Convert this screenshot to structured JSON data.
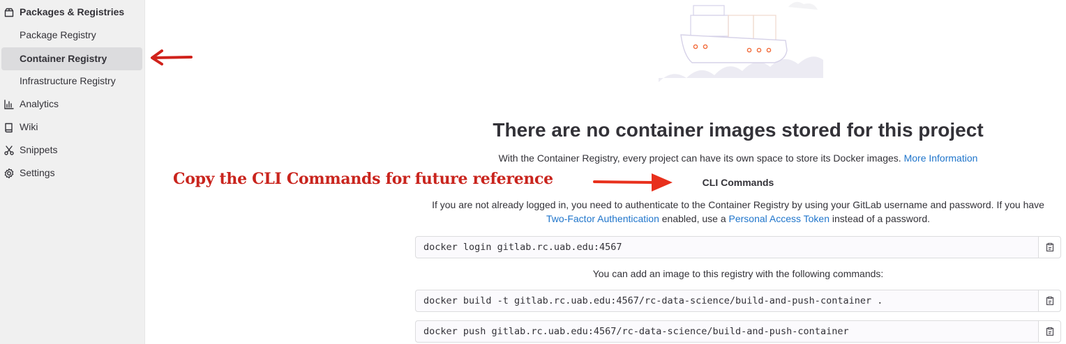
{
  "sidebar": {
    "items": [
      {
        "label": "Packages & Registries",
        "icon": "package-icon"
      },
      {
        "label": "Package Registry"
      },
      {
        "label": "Container Registry"
      },
      {
        "label": "Infrastructure Registry"
      },
      {
        "label": "Analytics",
        "icon": "chart-icon"
      },
      {
        "label": "Wiki",
        "icon": "book-icon"
      },
      {
        "label": "Snippets",
        "icon": "scissors-icon"
      },
      {
        "label": "Settings",
        "icon": "gear-icon"
      }
    ]
  },
  "annotation": {
    "text": "Copy the CLI Commands for future reference",
    "color": "#c9241d"
  },
  "main": {
    "title": "There are no container images stored for this project",
    "description": "With the Container Registry, every project can have its own space to store its Docker images.",
    "more_info_link": "More Information",
    "cli_heading": "CLI Commands",
    "auth_text_1": "If you are not already logged in, you need to authenticate to the Container Registry by using your GitLab username and password. If you have",
    "two_factor_link": "Two-Factor Authentication",
    "auth_text_2": "enabled, use a",
    "pat_link": "Personal Access Token",
    "auth_text_3": "instead of a password.",
    "login_command": "docker login gitlab.rc.uab.edu:4567",
    "add_image_text": "You can add an image to this registry with the following commands:",
    "build_command": "docker build -t gitlab.rc.uab.edu:4567/rc-data-science/build-and-push-container .",
    "push_command": "docker push gitlab.rc.uab.edu:4567/rc-data-science/build-and-push-container"
  },
  "colors": {
    "link": "#1f75cb",
    "active_nav_bg": "#dcdcde",
    "sidebar_bg": "#f0f0f0"
  }
}
